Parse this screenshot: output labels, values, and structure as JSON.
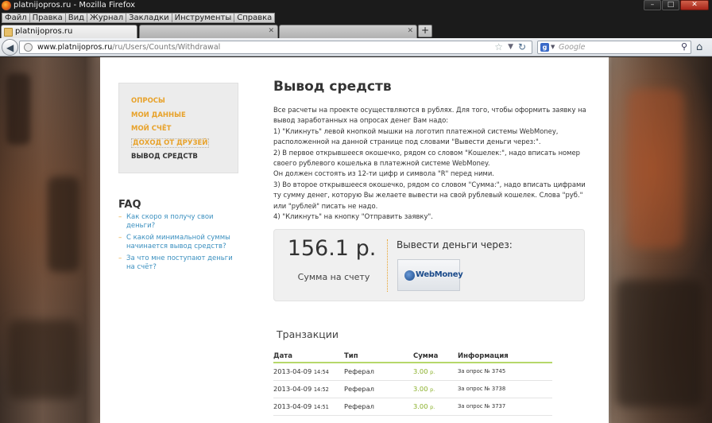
{
  "window": {
    "title": "platnijopros.ru - Mozilla Firefox",
    "controls": [
      "–",
      "□",
      "✕"
    ]
  },
  "menu": [
    "Файл",
    "Правка",
    "Вид",
    "Журнал",
    "Закладки",
    "Инструменты",
    "Справка"
  ],
  "tabs": [
    {
      "label": "platnijopros.ru",
      "active": true
    },
    {
      "label": "",
      "active": false
    },
    {
      "label": "",
      "active": false
    }
  ],
  "nav": {
    "url_host": "www.platnijopros.ru",
    "url_path": "/ru/Users/Counts/Withdrawal",
    "search_placeholder": "Google",
    "search_engine": "g"
  },
  "sidebar": {
    "items": [
      {
        "label": "Опросы"
      },
      {
        "label": "Мои данные"
      },
      {
        "label": "Мой счёт"
      },
      {
        "label": "Доход от друзей"
      },
      {
        "label": "Вывод средств"
      }
    ]
  },
  "faq": {
    "title": "FAQ",
    "items": [
      "Как скоро я получу свои деньги?",
      "С какой минимальной суммы начинается вывод средств?",
      "За что мне поступают деньги на счёт?"
    ]
  },
  "main": {
    "title": "Вывод средств",
    "intro": [
      "Все расчеты на проекте осуществляются в рублях. Для того, чтобы оформить заявку на вывод заработанных на опросах денег Вам надо:",
      "1) \"Кликнуть\" левой кнопкой мышки на логотип платежной системы WebMoney, расположенной на данной странице под словами \"Вывести деньги через:\".",
      "2) В первое открывшееся окошечко, рядом со словом \"Кошелек:\", надо вписать номер своего рублевого кошелька в платежной системе WebMoney.",
      "Он должен состоять из 12-ти цифр и символа \"R\" перед ними.",
      "3) Во второе открывшееся окошечко, рядом со словом \"Сумма:\", надо вписать цифрами ту сумму денег, которую Вы желаете вывести на свой рублевый кошелек. Слова \"руб.\" или \"рублей\" писать не надо.",
      "4) \"Кликнуть\" на кнопку \"Отправить заявку\"."
    ],
    "balance": {
      "amount": "156.1 р.",
      "caption": "Сумма на счету"
    },
    "withdraw_label": "Вывести деньги через:",
    "webmoney_label": "WebMoney"
  },
  "transactions": {
    "title": "Транзакции",
    "headers": [
      "Дата",
      "Тип",
      "Сумма",
      "Информация"
    ],
    "rows": [
      {
        "date": "2013-04-09",
        "time": "14:54",
        "type": "Реферал",
        "amount": "3.00",
        "currency": "р.",
        "info": "За опрос № 3745"
      },
      {
        "date": "2013-04-09",
        "time": "14:52",
        "type": "Реферал",
        "amount": "3.00",
        "currency": "р.",
        "info": "За опрос № 3738"
      },
      {
        "date": "2013-04-09",
        "time": "14:51",
        "type": "Реферал",
        "amount": "3.00",
        "currency": "р.",
        "info": "За опрос № 3737"
      }
    ]
  },
  "colors": {
    "accent_orange": "#e8a22a",
    "link_blue": "#3a8fbf",
    "amount_green": "#8ab02a",
    "table_rule_green": "#b6d86a"
  }
}
